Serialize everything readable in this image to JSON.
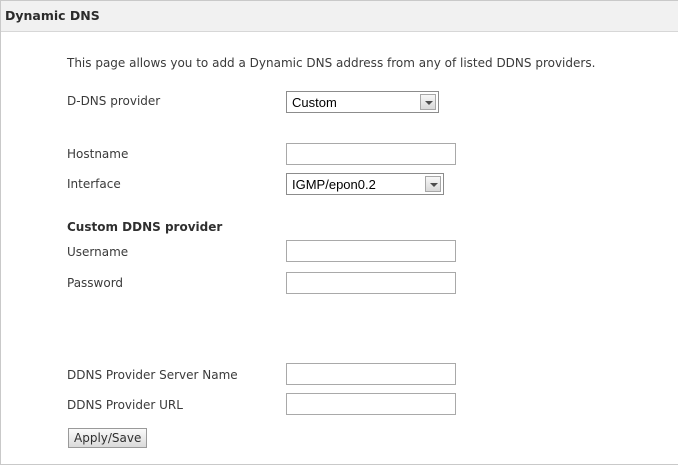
{
  "page": {
    "title": "Dynamic DNS",
    "description": "This page allows you to add a Dynamic DNS address from any of listed DDNS providers."
  },
  "form": {
    "provider": {
      "label": "D-DNS provider",
      "value": "Custom"
    },
    "hostname": {
      "label": "Hostname",
      "value": ""
    },
    "interface": {
      "label": "Interface",
      "value": "IGMP/epon0.2"
    },
    "custom_section": {
      "title": "Custom DDNS provider"
    },
    "username": {
      "label": "Username",
      "value": ""
    },
    "password": {
      "label": "Password",
      "value": ""
    },
    "server_name": {
      "label": "DDNS Provider Server Name",
      "value": ""
    },
    "provider_url": {
      "label": "DDNS Provider URL",
      "value": ""
    }
  },
  "actions": {
    "apply_save": "Apply/Save"
  }
}
